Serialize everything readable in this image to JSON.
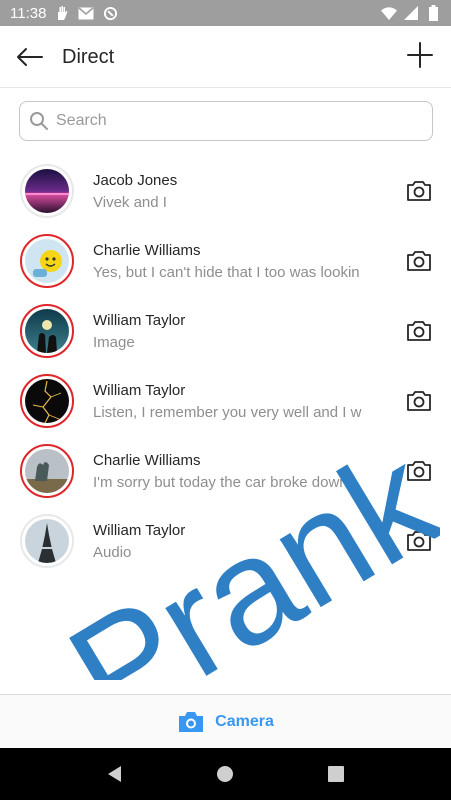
{
  "status_bar": {
    "time": "11:38",
    "left_icons": [
      "hand-icon",
      "mail-icon",
      "data-saver-icon"
    ],
    "right_icons": [
      "wifi-icon",
      "cellular-icon",
      "battery-icon"
    ]
  },
  "header": {
    "title": "Direct",
    "back_icon": "arrow-left-icon",
    "add_icon": "plus-icon"
  },
  "search": {
    "placeholder": "Search",
    "value": ""
  },
  "chats": [
    {
      "name": "Jacob Jones",
      "preview": "Vivek and I",
      "story_ring": false,
      "avatar": "purple-sunset"
    },
    {
      "name": "Charlie Williams",
      "preview": "Yes, but I can't hide that I too was lookin",
      "story_ring": true,
      "avatar": "smiley-alarm"
    },
    {
      "name": "William Taylor",
      "preview": "Image",
      "story_ring": true,
      "avatar": "couple-silhouette"
    },
    {
      "name": "William Taylor",
      "preview": "Listen, I remember you very well and I w",
      "story_ring": true,
      "avatar": "lightning-dark"
    },
    {
      "name": "Charlie Williams",
      "preview": "I'm sorry but today the car broke down",
      "story_ring": true,
      "avatar": "foggy-tree"
    },
    {
      "name": "William Taylor",
      "preview": "Audio",
      "story_ring": false,
      "avatar": "eiffel-tower"
    }
  ],
  "watermark": {
    "text": "Prank",
    "color": "#2f7fc4"
  },
  "bottom_bar": {
    "label": "Camera",
    "icon": "camera-filled-icon",
    "color": "#3897f0"
  },
  "nav_bar": {
    "buttons": [
      "back-triangle-icon",
      "home-circle-icon",
      "recents-square-icon"
    ]
  },
  "colors": {
    "story_ring": "#e0252a",
    "accent": "#3897f0",
    "status_bar": "#9e9e9e"
  }
}
